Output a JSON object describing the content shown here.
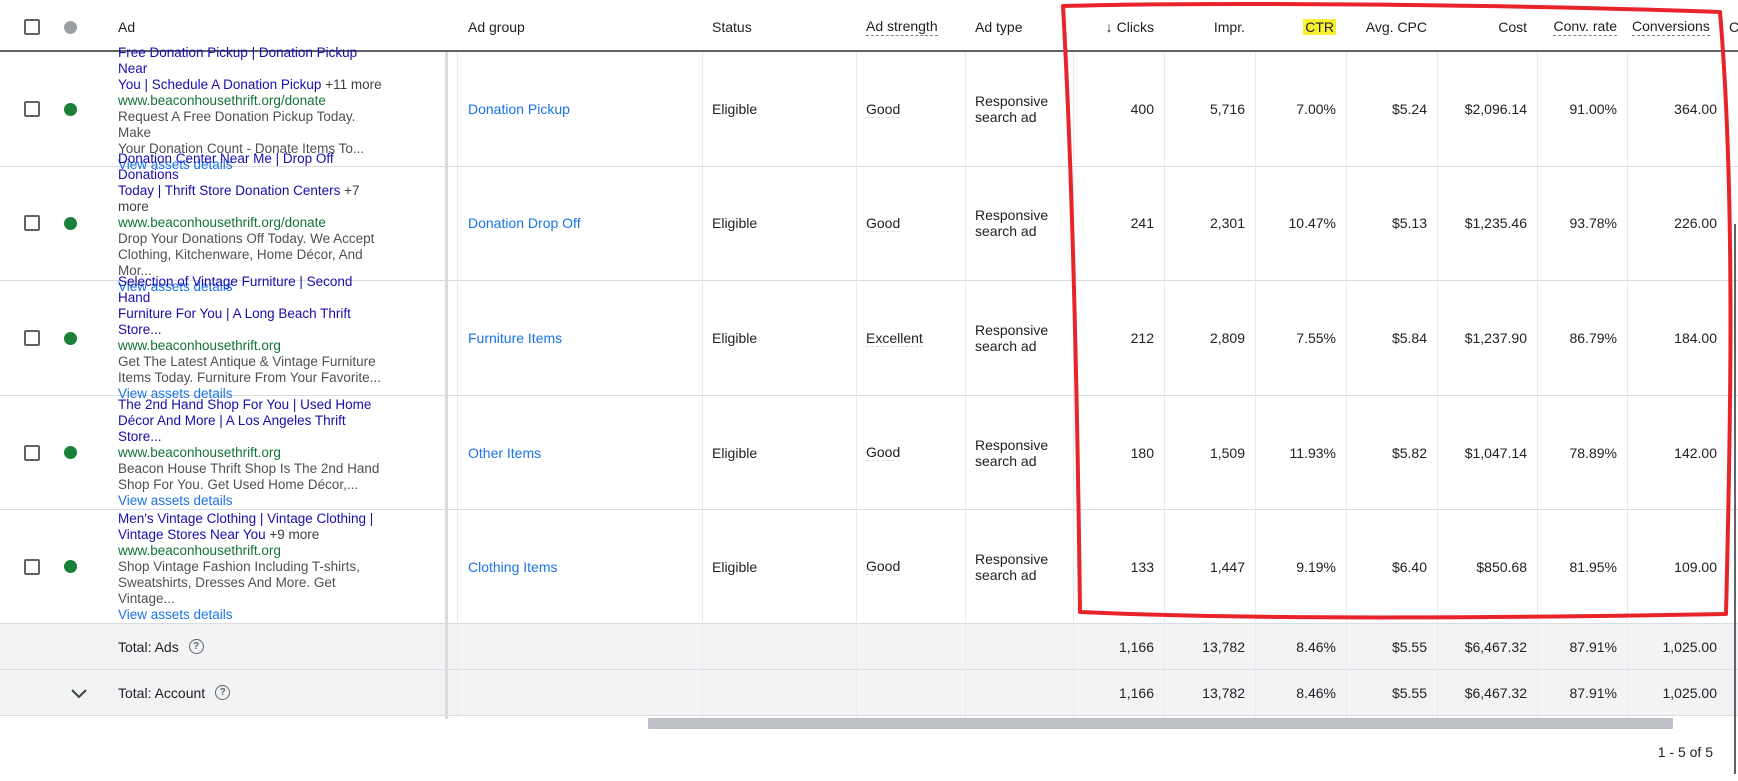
{
  "header": {
    "ad": "Ad",
    "ad_group": "Ad group",
    "status": "Status",
    "ad_strength": "Ad strength",
    "ad_type": "Ad type",
    "clicks": "Clicks",
    "impr": "Impr.",
    "ctr": "CTR",
    "avg_cpc": "Avg. CPC",
    "cost": "Cost",
    "conv_rate": "Conv. rate",
    "conversions": "Conversions",
    "cut_col": "Co",
    "sort_arrow": "↓"
  },
  "rows": [
    {
      "title_line1": "Free Donation Pickup | Donation Pickup Near",
      "title_line2": "You | Schedule A Donation Pickup",
      "more": "+11 more",
      "url": "www.beaconhousethrift.org/donate",
      "desc_line1": "Request A Free Donation Pickup Today. Make",
      "desc_line2": "Your Donation Count - Donate Items To...",
      "assets": "View assets details",
      "ad_group": "Donation Pickup",
      "status": "Eligible",
      "strength": "Good",
      "type_line1": "Responsive",
      "type_line2": "search ad",
      "clicks": "400",
      "impr": "5,716",
      "ctr": "7.00%",
      "cpc": "$5.24",
      "cost": "$2,096.14",
      "conv_rate": "91.00%",
      "conversions": "364.00"
    },
    {
      "title_line1": "Donation Center Near Me | Drop Off Donations",
      "title_line2": "Today | Thrift Store Donation Centers",
      "more": "+7 more",
      "url": "www.beaconhousethrift.org/donate",
      "desc_line1": "Drop Your Donations Off Today. We Accept",
      "desc_line2": "Clothing, Kitchenware, Home Décor, And Mor...",
      "assets": "View assets details",
      "ad_group": "Donation Drop Off",
      "status": "Eligible",
      "strength": "Good",
      "type_line1": "Responsive",
      "type_line2": "search ad",
      "clicks": "241",
      "impr": "2,301",
      "ctr": "10.47%",
      "cpc": "$5.13",
      "cost": "$1,235.46",
      "conv_rate": "93.78%",
      "conversions": "226.00"
    },
    {
      "title_line1": "Selection of Vintage Furniture | Second Hand",
      "title_line2": "Furniture For You | A Long Beach Thrift Store...",
      "more": "",
      "url": "www.beaconhousethrift.org",
      "desc_line1": "Get The Latest Antique & Vintage Furniture",
      "desc_line2": "Items Today. Furniture From Your Favorite...",
      "assets": "View assets details",
      "ad_group": "Furniture Items",
      "status": "Eligible",
      "strength": "Excellent",
      "type_line1": "Responsive",
      "type_line2": "search ad",
      "clicks": "212",
      "impr": "2,809",
      "ctr": "7.55%",
      "cpc": "$5.84",
      "cost": "$1,237.90",
      "conv_rate": "86.79%",
      "conversions": "184.00"
    },
    {
      "title_line1": "The 2nd Hand Shop For You | Used Home",
      "title_line2": "Décor And More | A Los Angeles Thrift Store...",
      "more": "",
      "url": "www.beaconhousethrift.org",
      "desc_line1": "Beacon House Thrift Shop Is The 2nd Hand",
      "desc_line2": "Shop For You. Get Used Home Décor,...",
      "assets": "View assets details",
      "ad_group": "Other Items",
      "status": "Eligible",
      "strength": "Good",
      "type_line1": "Responsive",
      "type_line2": "search ad",
      "clicks": "180",
      "impr": "1,509",
      "ctr": "11.93%",
      "cpc": "$5.82",
      "cost": "$1,047.14",
      "conv_rate": "78.89%",
      "conversions": "142.00"
    },
    {
      "title_line1": "Men's Vintage Clothing | Vintage Clothing |",
      "title_line2": "Vintage Stores Near You",
      "more": "+9 more",
      "url": "www.beaconhousethrift.org",
      "desc_line1": "Shop Vintage Fashion Including T-shirts,",
      "desc_line2": "Sweatshirts, Dresses And More. Get Vintage...",
      "assets": "View assets details",
      "ad_group": "Clothing Items",
      "status": "Eligible",
      "strength": "Good",
      "type_line1": "Responsive",
      "type_line2": "search ad",
      "clicks": "133",
      "impr": "1,447",
      "ctr": "9.19%",
      "cpc": "$6.40",
      "cost": "$850.68",
      "conv_rate": "81.95%",
      "conversions": "109.00"
    }
  ],
  "totals": [
    {
      "label": "Total: Ads",
      "clicks": "1,166",
      "impr": "13,782",
      "ctr": "8.46%",
      "cpc": "$5.55",
      "cost": "$6,467.32",
      "conv_rate": "87.91%",
      "conversions": "1,025.00"
    },
    {
      "label": "Total: Account",
      "clicks": "1,166",
      "impr": "13,782",
      "ctr": "8.46%",
      "cpc": "$5.55",
      "cost": "$6,467.32",
      "conv_rate": "87.91%",
      "conversions": "1,025.00"
    }
  ],
  "pager": "1 - 5 of 5",
  "icons": {
    "help": "help-circle-icon",
    "expand": "chevron-down-icon",
    "sort": "arrow-down-icon"
  },
  "colors": {
    "annotation": "#e8232a",
    "highlight": "#f8f032",
    "eligible_dot": "#188038"
  }
}
